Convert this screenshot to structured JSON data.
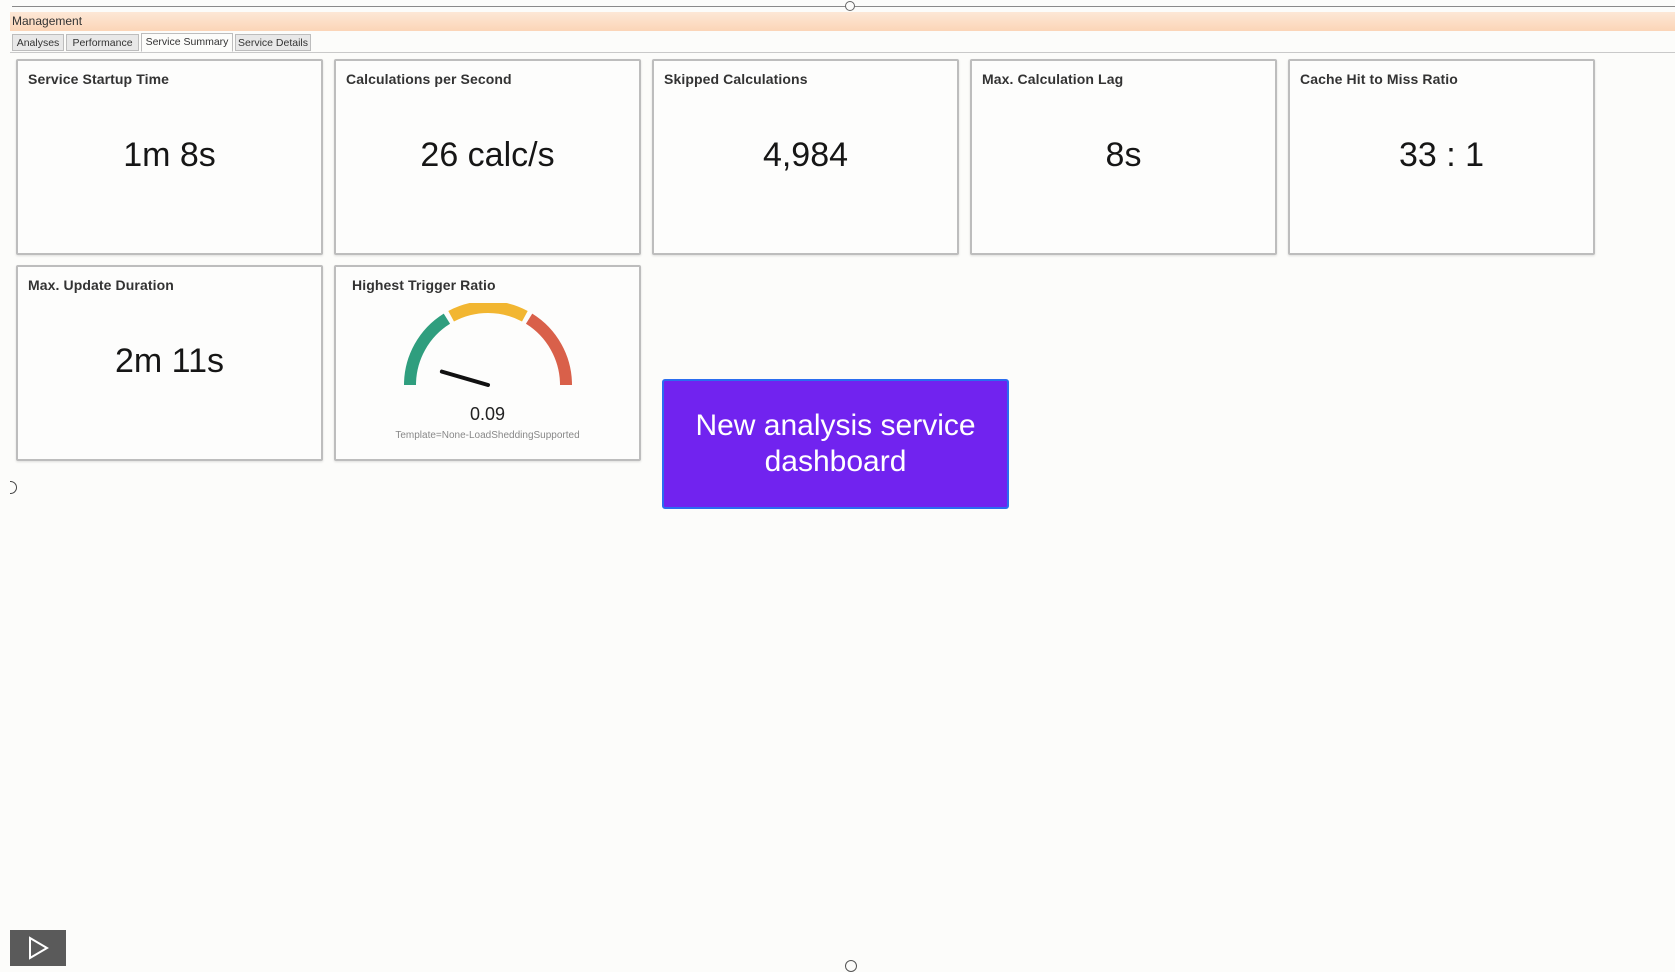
{
  "window": {
    "title": "Management"
  },
  "tabs": [
    {
      "label": "Analyses",
      "active": false
    },
    {
      "label": "Performance",
      "active": false
    },
    {
      "label": "Service Summary",
      "active": true
    },
    {
      "label": "Service Details",
      "active": false
    }
  ],
  "tiles": [
    {
      "title": "Service Startup Time",
      "value": "1m 8s"
    },
    {
      "title": "Calculations per Second",
      "value": "26 calc/s"
    },
    {
      "title": "Skipped Calculations",
      "value": "4,984"
    },
    {
      "title": "Max. Calculation Lag",
      "value": "8s"
    },
    {
      "title": "Cache Hit to Miss Ratio",
      "value": "33 : 1"
    },
    {
      "title": "Max. Update Duration",
      "value": "2m 11s"
    }
  ],
  "gauge": {
    "title": "Highest Trigger Ratio",
    "value_text": "0.09",
    "value": 0.09,
    "caption": "Template=None-LoadSheddingSupported",
    "bands": [
      {
        "color": "#2f9e7e"
      },
      {
        "color": "#f2b631"
      },
      {
        "color": "#d9604a"
      }
    ]
  },
  "banner": {
    "text": "New analysis service dashboard",
    "color": "#7123ef"
  },
  "player": {
    "icon": "play-icon"
  }
}
